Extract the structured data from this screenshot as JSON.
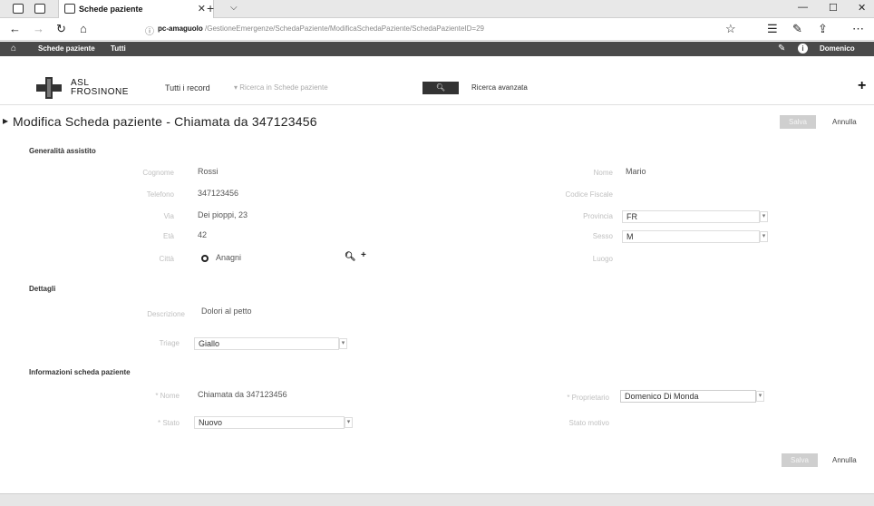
{
  "browser": {
    "tab_title": "Schede paziente",
    "url_host": "pc-amaguolo",
    "url_rest": "/GestioneEmergenze/SchedaPaziente/ModificaSchedaPaziente/SchedaPazienteID=29"
  },
  "appnav": {
    "link1": "Schede paziente",
    "link2": "Tutti",
    "user": "Domenico",
    "user_icon": "i"
  },
  "header": {
    "logo_line1": "ASL",
    "logo_line2": "FROSINONE",
    "record_selector": "Tutti i record",
    "search_placeholder": "Ricerca in Schede paziente",
    "advanced_search": "Ricerca avanzata"
  },
  "page": {
    "title": "Modifica Scheda paziente - Chiamata da 347123456",
    "save": "Salva",
    "cancel": "Annulla"
  },
  "sections": {
    "general": "Generalità assistito",
    "details": "Dettagli",
    "info": "Informazioni scheda paziente"
  },
  "general": {
    "cognome_label": "Cognome",
    "cognome": "Rossi",
    "nome_label": "Nome",
    "nome": "Mario",
    "telefono_label": "Telefono",
    "telefono": "347123456",
    "codice_fiscale_label": "Codice Fiscale",
    "via_label": "Via",
    "via": "Dei pioppi, 23",
    "provincia_label": "Provincia",
    "provincia": "FR",
    "eta_label": "Età",
    "eta": "42",
    "sesso_label": "Sesso",
    "sesso": "M",
    "citta_label": "Città",
    "citta": "Anagni",
    "luogo_label": "Luogo"
  },
  "details": {
    "descrizione_label": "Descrizione",
    "descrizione": "Dolori al petto",
    "triage_label": "Triage",
    "triage": "Giallo"
  },
  "info": {
    "nome_label": "* Nome",
    "nome": "Chiamata da 347123456",
    "proprietario_label": "* Proprietario",
    "proprietario": "Domenico Di Monda",
    "stato_label": "* Stato",
    "stato": "Nuovo",
    "stato_motivo_label": "Stato motivo"
  },
  "colors": {
    "appbar": "#4a4a4a",
    "search_button": "#333333",
    "save_button": "#cfcfcf"
  }
}
